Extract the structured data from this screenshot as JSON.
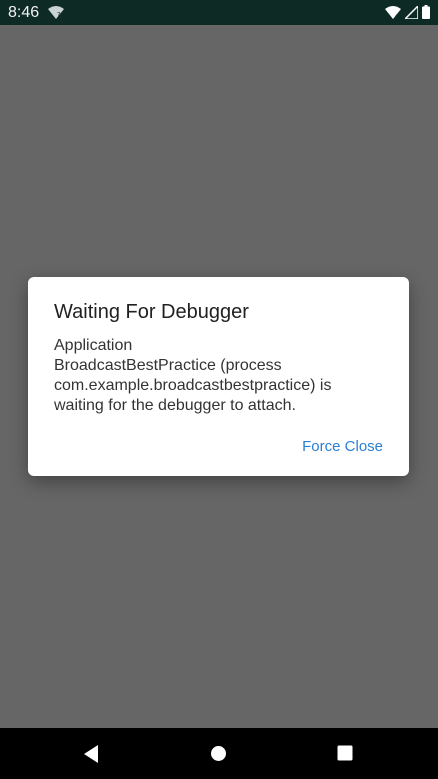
{
  "status_bar": {
    "time": "8:46",
    "icons": [
      "wifi-unknown-icon",
      "wifi-icon",
      "signal-icon",
      "battery-icon"
    ]
  },
  "dialog": {
    "title": "Waiting For Debugger",
    "message_lines": [
      "Application",
      "BroadcastBestPractice (process",
      "com.example.broadcastbestpractice) is",
      "waiting for the debugger to attach."
    ],
    "button_label": "Force Close",
    "accent_color": "#2a7fd4"
  },
  "nav_bar": {
    "buttons": [
      "back-icon",
      "home-icon",
      "recents-icon"
    ]
  }
}
